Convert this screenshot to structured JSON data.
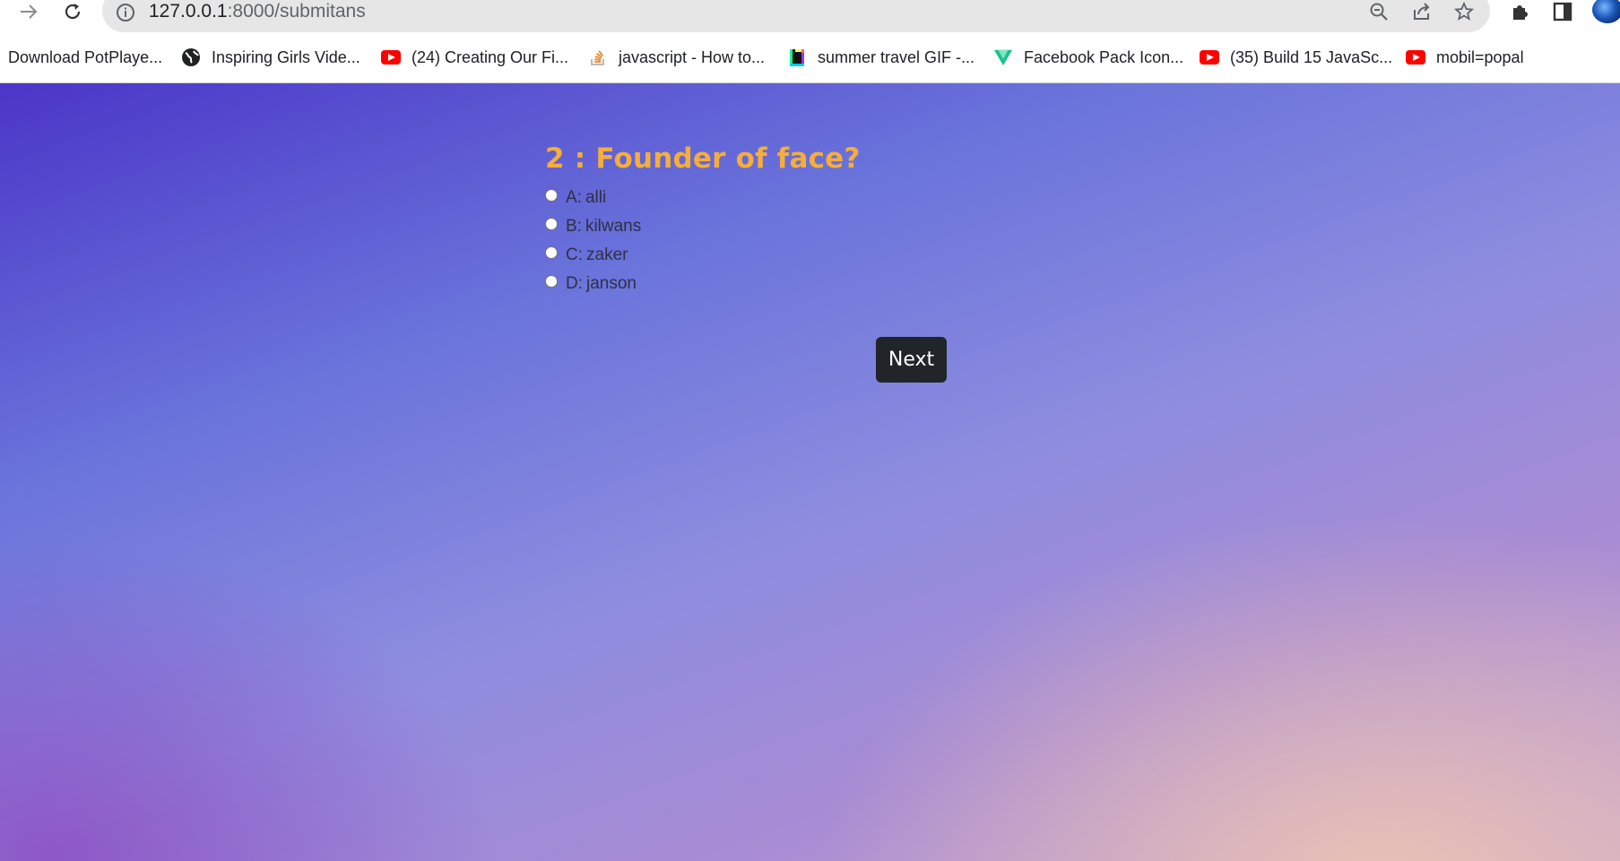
{
  "browser": {
    "url_host": "127.0.0.1",
    "url_path": ":8000/submitans",
    "bookmarks": [
      {
        "label": "Download PotPlaye...",
        "icon": "none"
      },
      {
        "label": "Inspiring Girls Vide...",
        "icon": "globe-icon"
      },
      {
        "label": "(24) Creating Our Fi...",
        "icon": "youtube-icon"
      },
      {
        "label": "javascript - How to...",
        "icon": "stackoverflow-icon"
      },
      {
        "label": "summer travel GIF -...",
        "icon": "giphy-icon"
      },
      {
        "label": "Facebook Pack Icon...",
        "icon": "vuetify-icon"
      },
      {
        "label": "(35) Build 15 JavaSc...",
        "icon": "youtube-icon"
      },
      {
        "label": "mobil=popal",
        "icon": "youtube-icon"
      }
    ]
  },
  "quiz": {
    "question": "2 : Founder of face?",
    "options": [
      {
        "letter": "A:",
        "text": "alli"
      },
      {
        "letter": "B:",
        "text": "kilwans"
      },
      {
        "letter": "C:",
        "text": "zaker"
      },
      {
        "letter": "D:",
        "text": "janson"
      }
    ],
    "next_label": "Next"
  },
  "colors": {
    "question": "#f5ad3b",
    "button": "#212529"
  }
}
